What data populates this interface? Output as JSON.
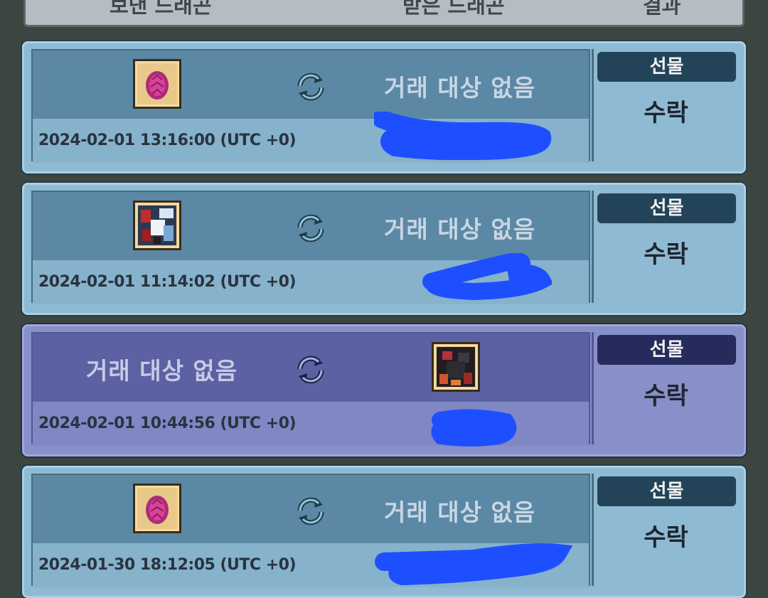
{
  "header": {
    "sent_label": "보낸 드래곤",
    "received_label": "받은 드래곤",
    "result_label": "결과"
  },
  "trades": [
    {
      "theme": "blue",
      "no_target_label": "거래 대상 없음",
      "item_icon": "pink-egg-icon",
      "timestamp": "2024-02-01 13:16:00 (UTC +0)",
      "type_label": "선물",
      "result_label": "수락"
    },
    {
      "theme": "blue",
      "no_target_label": "거래 대상 없음",
      "item_icon": "dragon-portrait-icon",
      "timestamp": "2024-02-01 11:14:02 (UTC +0)",
      "type_label": "선물",
      "result_label": "수락"
    },
    {
      "theme": "purple",
      "no_target_label": "거래 대상 없음",
      "item_icon": "dark-dragon-portrait-icon",
      "timestamp": "2024-02-01 10:44:56 (UTC +0)",
      "type_label": "선물",
      "result_label": "수락"
    },
    {
      "theme": "blue",
      "no_target_label": "거래 대상 없음",
      "item_icon": "pink-egg-icon",
      "timestamp": "2024-01-30 18:12:05 (UTC +0)",
      "type_label": "선물",
      "result_label": "수락"
    }
  ],
  "colors": {
    "background": "#3c4540",
    "card_blue": "#8fbad3",
    "card_purple": "#8790c9",
    "redaction": "#1e4fff"
  }
}
